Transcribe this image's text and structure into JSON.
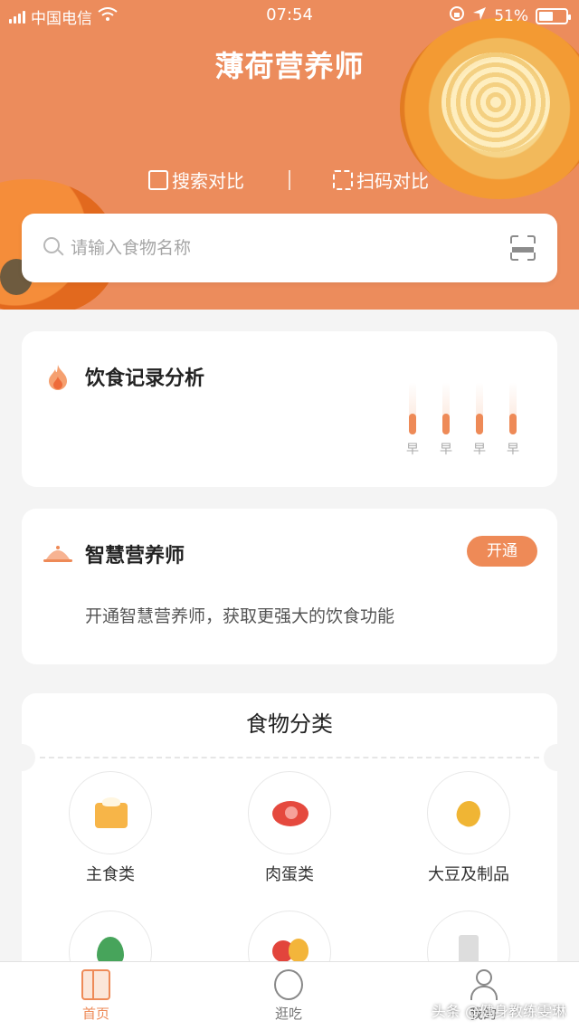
{
  "status_bar": {
    "carrier": "中国电信",
    "time": "07:54",
    "battery": "51%",
    "icons": [
      "signal-icon",
      "wifi-icon",
      "rotation-lock-icon",
      "location-icon",
      "battery-icon"
    ]
  },
  "header": {
    "title": "薄荷营养师",
    "search_compare_label": "搜索对比",
    "scan_compare_label": "扫码对比",
    "accent": "#ec8c5c"
  },
  "search": {
    "placeholder": "请输入食物名称",
    "value": ""
  },
  "diet_record": {
    "title": "饮食记录分析",
    "bars": [
      {
        "label": "早",
        "level": 0.4
      },
      {
        "label": "早",
        "level": 0.4
      },
      {
        "label": "早",
        "level": 0.4
      },
      {
        "label": "早",
        "level": 0.4
      }
    ]
  },
  "smart_nutritionist": {
    "title": "智慧营养师",
    "open_label": "开通",
    "description": "开通智慧营养师，获取更强大的饮食功能"
  },
  "food_categories": {
    "title": "食物分类",
    "items": [
      {
        "label": "主食类",
        "icon": "staple-food-icon"
      },
      {
        "label": "肉蛋类",
        "icon": "meat-icon"
      },
      {
        "label": "大豆及制品",
        "icon": "soybean-icon"
      },
      {
        "label": "",
        "icon": "vegetable-icon"
      },
      {
        "label": "",
        "icon": "fruit-icon"
      },
      {
        "label": "",
        "icon": "milk-icon"
      }
    ]
  },
  "tabbar": {
    "home": "首页",
    "explore": "逛吃",
    "mine": "我的"
  },
  "watermark": "头条 @健身教练雯琳"
}
